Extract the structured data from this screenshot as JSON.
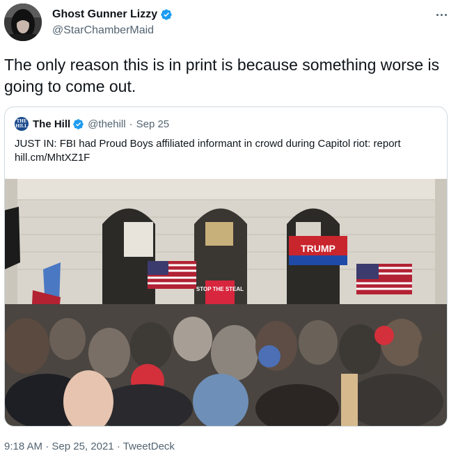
{
  "author": {
    "display_name": "Ghost Gunner Lizzy",
    "handle": "@StarChamberMaid",
    "verified": true
  },
  "icons": {
    "verified": "verified-badge-icon",
    "more": "more-horizontal-icon"
  },
  "tweet": {
    "text": "The only reason this is in print is because something worse is going to come out."
  },
  "quoted_tweet": {
    "logo_text": "THE HILL",
    "display_name": "The Hill",
    "handle": "@thehill",
    "separator": "·",
    "date": "Sep 25",
    "text": "JUST IN: FBI had Proud Boys affiliated informant in crowd during Capitol riot: report hill.cm/MhtXZ1F",
    "image": {
      "sign_text": "STOP THE STEAL",
      "banner_text": "TRUMP"
    }
  },
  "meta": {
    "time": "9:18 AM",
    "date": "Sep 25, 2021",
    "source": "TweetDeck",
    "separator": "·"
  },
  "colors": {
    "accent": "#1d9bf0",
    "text": "#0f1419",
    "muted": "#536471",
    "border": "#cfd9de"
  }
}
